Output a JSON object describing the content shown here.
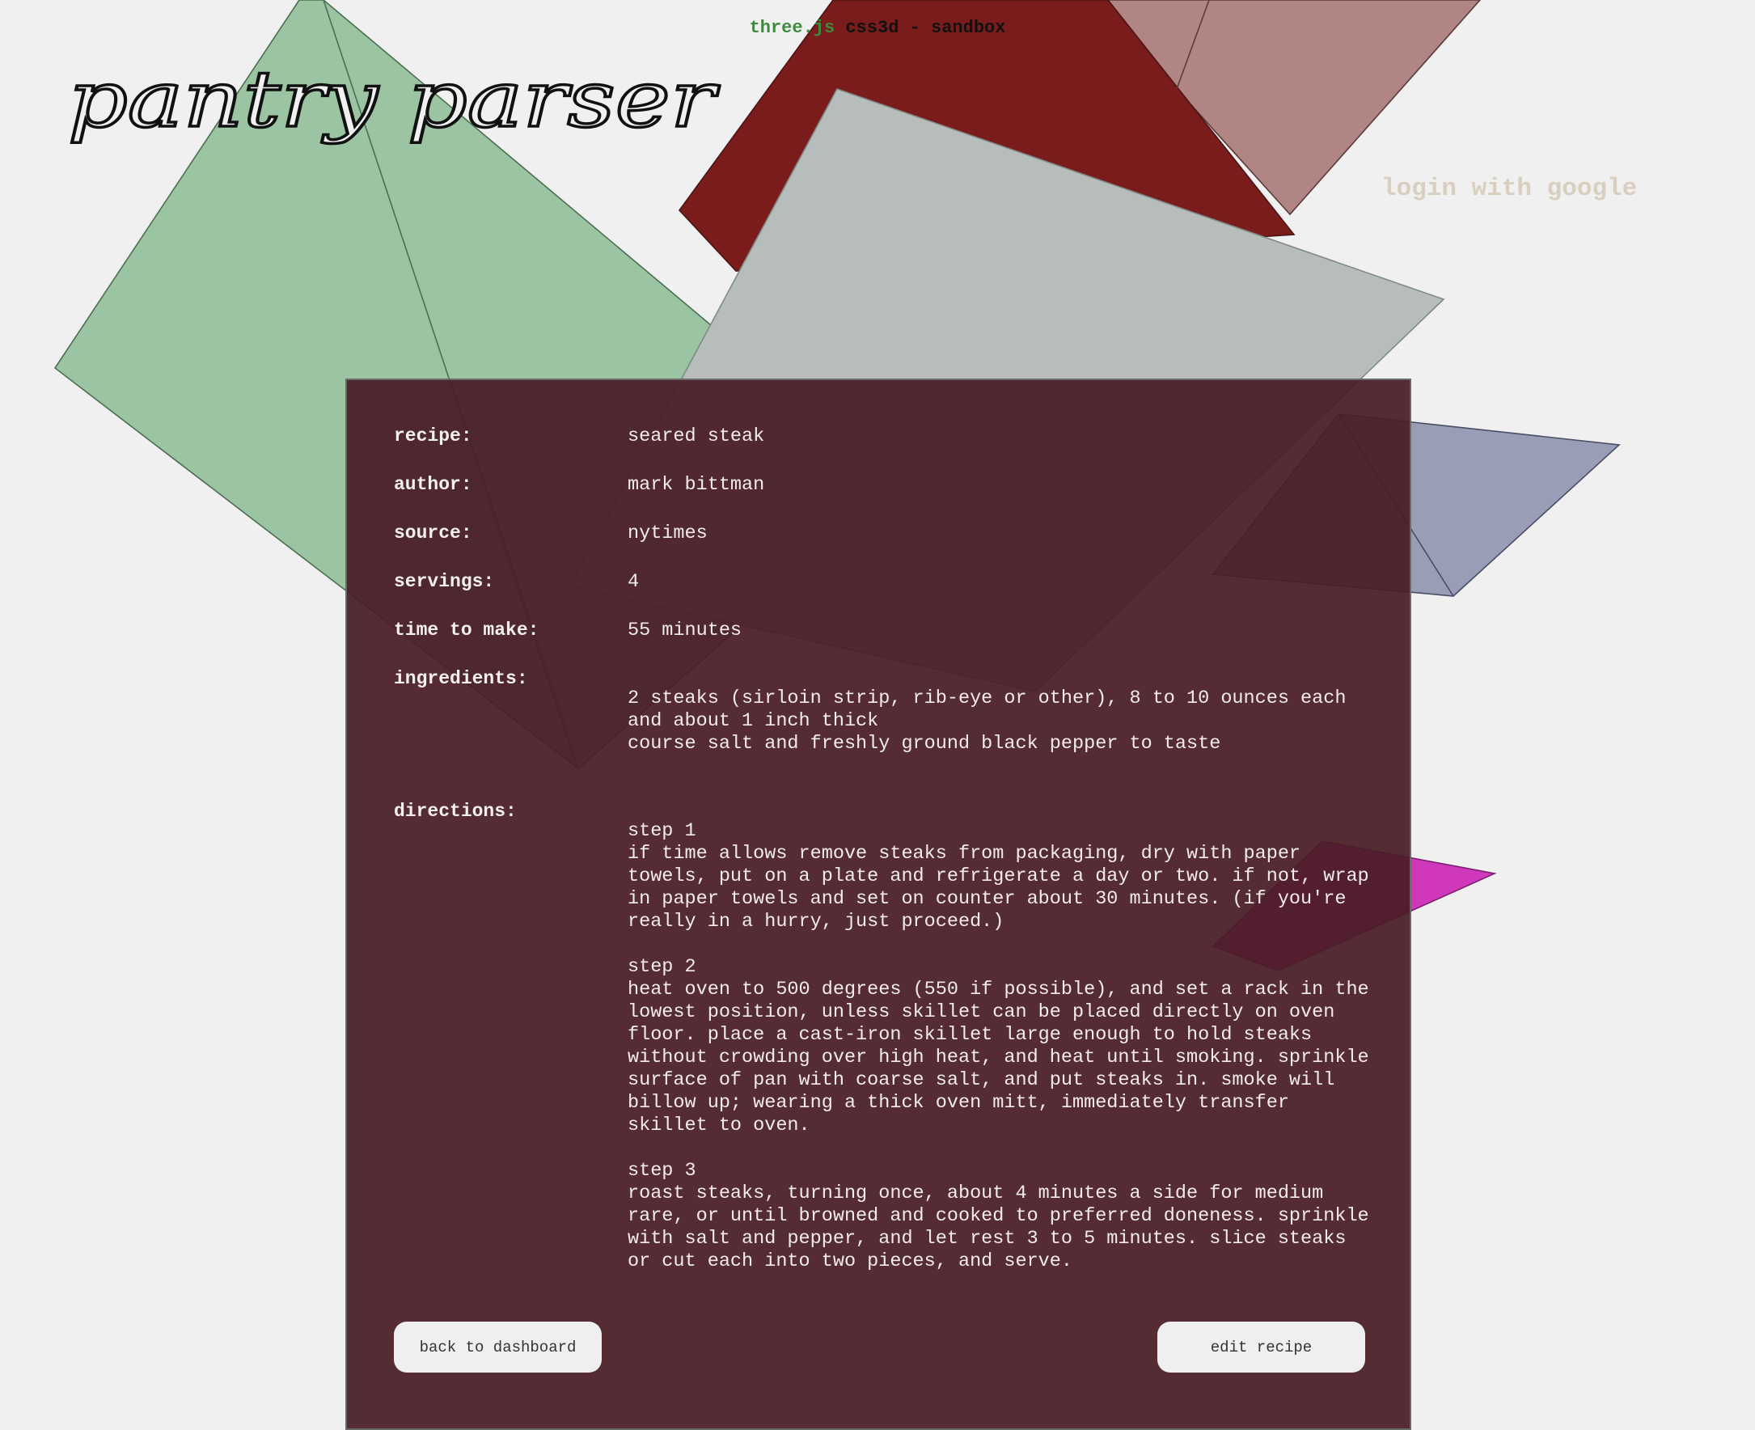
{
  "header": {
    "lib_name": "three.js",
    "demo_name": "css3d - sandbox"
  },
  "brand": {
    "logo_text": "pantry parser"
  },
  "nav": {
    "login_label": "login with google"
  },
  "recipe": {
    "fields": {
      "recipe_label": "recipe:",
      "recipe_value": "seared steak",
      "author_label": "author:",
      "author_value": "mark bittman",
      "source_label": "source:",
      "source_value": "nytimes",
      "servings_label": "servings:",
      "servings_value": "4",
      "time_label": "time to make:",
      "time_value": "55 minutes",
      "ingredients_label": "ingredients:",
      "directions_label": "directions:"
    },
    "ingredients": [
      "2 steaks (sirloin strip, rib-eye or other), 8 to 10 ounces each and about 1 inch thick",
      "course salt and freshly ground black pepper to taste"
    ],
    "directions": [
      {
        "title": "step 1",
        "text": "if time allows remove steaks from packaging, dry with paper towels, put on a plate and refrigerate a day or two. if not, wrap in paper towels and set on counter about 30 minutes. (if you're really in a hurry, just proceed.)"
      },
      {
        "title": "step 2",
        "text": "heat oven to 500 degrees (550 if possible), and set a rack in the lowest position, unless skillet can be placed directly on oven floor. place a cast-iron skillet large enough to hold steaks without crowding over high heat, and heat until smoking. sprinkle surface of pan with coarse salt, and put steaks in. smoke will billow up; wearing a thick oven mitt, immediately transfer skillet to oven."
      },
      {
        "title": "step 3",
        "text": "roast steaks, turning once, about 4 minutes a side for medium rare, or until browned and cooked to preferred doneness. sprinkle with salt and pepper, and let rest 3 to 5 minutes. slice steaks or cut each into two pieces, and serve."
      }
    ]
  },
  "actions": {
    "back_label": "back to dashboard",
    "edit_label": "edit recipe"
  },
  "colors": {
    "panel_bg": "#491c26",
    "accent_green": "#3c8b3c",
    "login_text": "#d8cfbf",
    "shape_green": "#9bc4a2",
    "shape_red": "#7a1c1c",
    "shape_rose": "#b08584",
    "shape_gray": "#b6bdbb",
    "shape_slate": "#9a9db6",
    "shape_magenta": "#cf38bb"
  }
}
